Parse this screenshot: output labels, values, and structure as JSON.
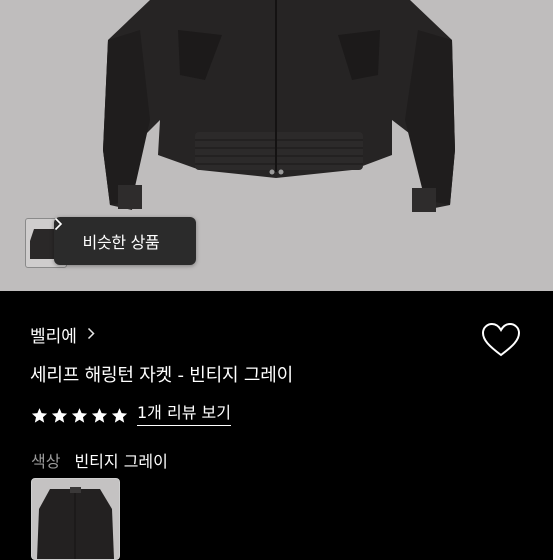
{
  "hero": {
    "image_icon": "jacket-product-photo",
    "similar_button": {
      "label": "비슷한 상품",
      "icon": "chevron-right-icon"
    }
  },
  "product": {
    "brand": "벨리에",
    "title": "세리프 해링턴 자켓 - 빈티지 그레이",
    "rating_stars": 5,
    "rating_max": 5,
    "review_link": "1개 리뷰 보기",
    "color_label": "색상",
    "color_value": "빈티지 그레이",
    "wishlist_icon": "heart-outline-icon"
  },
  "colors": {
    "background": "#000000",
    "hero_bg": "#bfbdbd",
    "jacket": "#262424",
    "star": "#ffffff"
  }
}
